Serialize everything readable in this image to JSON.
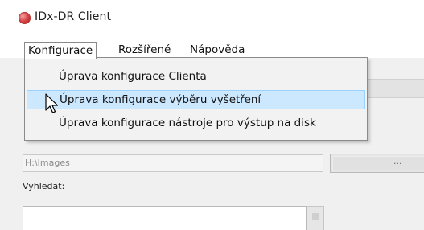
{
  "window": {
    "title": "IDx-DR Client",
    "app_icon": "red-circle-icon"
  },
  "menubar": {
    "items": [
      {
        "label": "Konfigurace",
        "open": true
      },
      {
        "label": "Rozšířené"
      },
      {
        "label": "Nápověda"
      }
    ]
  },
  "dropdown": {
    "items": [
      {
        "label": "Úprava konfigurace Clienta"
      },
      {
        "label": "Úprava konfigurace výběru vyšetření",
        "hovered": true
      },
      {
        "label": "Úprava konfigurace nástroje pro výstup na disk"
      }
    ]
  },
  "content": {
    "path_value": "H:\\Images",
    "browse_label": "...",
    "search_label": "Vyhledat:",
    "search_value": ""
  },
  "colors": {
    "menu_hover_bg": "#cce8ff",
    "menu_hover_border": "#99d1ff",
    "app_icon": "#d84545"
  }
}
